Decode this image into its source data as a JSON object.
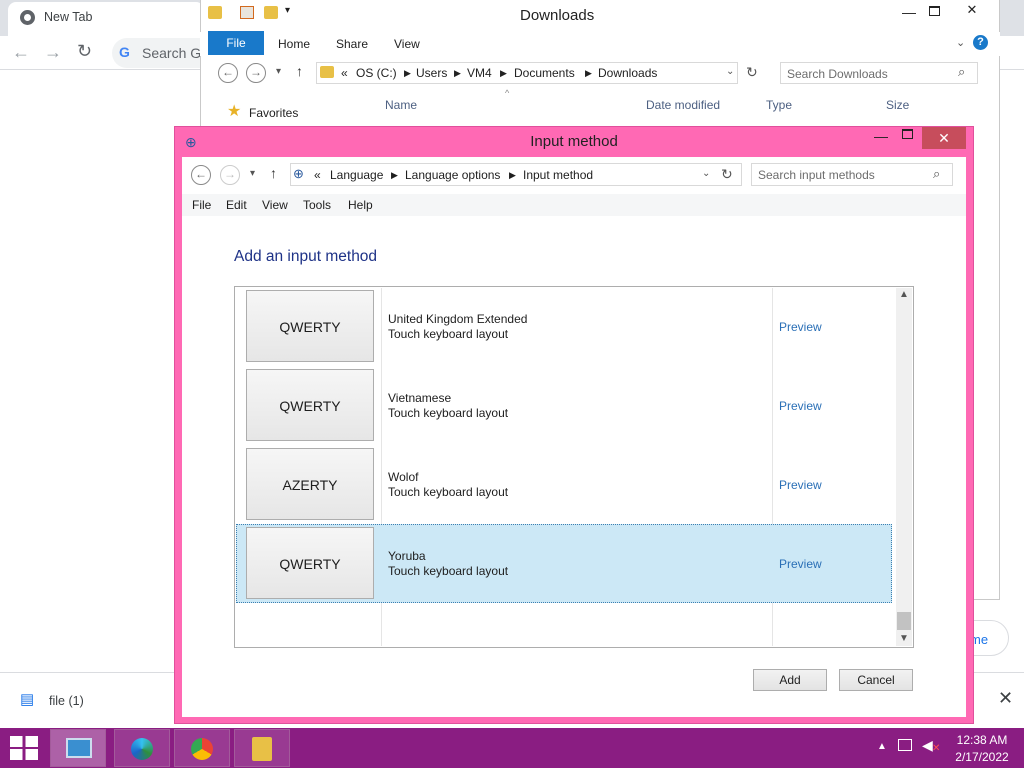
{
  "chrome": {
    "tab_title": "New Tab",
    "omnibox_text": "Search Go",
    "download_file": "file (1)",
    "pill_text": "me"
  },
  "explorer": {
    "title": "Downloads",
    "ribbon_tabs": [
      "File",
      "Home",
      "Share",
      "View"
    ],
    "breadcrumb": [
      "OS (C:)",
      "Users",
      "VM4",
      "Documents",
      "Downloads"
    ],
    "search_placeholder": "Search Downloads",
    "favorites": "Favorites",
    "columns": [
      "Name",
      "Date modified",
      "Type",
      "Size"
    ]
  },
  "ime": {
    "title": "Input method",
    "breadcrumb": [
      "Language",
      "Language options",
      "Input method"
    ],
    "search_placeholder": "Search input methods",
    "menu": [
      "File",
      "Edit",
      "View",
      "Tools",
      "Help"
    ],
    "heading": "Add an input method",
    "rows": [
      {
        "layout": "QWERTY",
        "name": "United Kingdom Extended",
        "desc": "Touch keyboard layout",
        "preview": "Preview",
        "selected": false
      },
      {
        "layout": "QWERTY",
        "name": "Vietnamese",
        "desc": "Touch keyboard layout",
        "preview": "Preview",
        "selected": false
      },
      {
        "layout": "AZERTY",
        "name": "Wolof",
        "desc": "Touch keyboard layout",
        "preview": "Preview",
        "selected": false
      },
      {
        "layout": "QWERTY",
        "name": "Yoruba",
        "desc": "Touch keyboard layout",
        "preview": "Preview",
        "selected": true
      }
    ],
    "add_button": "Add",
    "cancel_button": "Cancel"
  },
  "taskbar": {
    "time": "12:38 AM",
    "date": "2/17/2022"
  },
  "colors": {
    "ime_frame": "#ff69b4",
    "taskbar": "#8a1d82",
    "selection": "#cce8f6",
    "link": "#2a6fb6",
    "heading": "#1e3287"
  }
}
